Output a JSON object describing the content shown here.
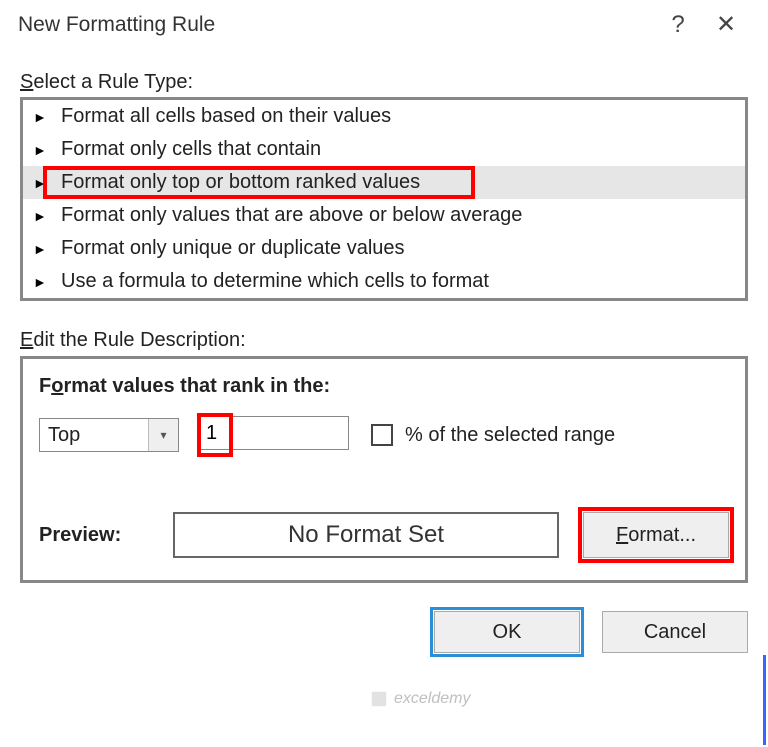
{
  "title": "New Formatting Rule",
  "help_icon": "?",
  "close_icon": "✕",
  "select_label_pre": "S",
  "select_label_rest": "elect a Rule Type:",
  "rules": [
    "Format all cells based on their values",
    "Format only cells that contain",
    "Format only top or bottom ranked values",
    "Format only values that are above or below average",
    "Format only unique or duplicate values",
    "Use a formula to determine which cells to format"
  ],
  "selected_rule_index": 2,
  "edit_label_pre": "E",
  "edit_label_rest": "dit the Rule Description:",
  "panel_title_pre": "F",
  "panel_title_und": "o",
  "panel_title_rest": "rmat values that rank in the:",
  "dropdown_value": "Top",
  "number_value": "1",
  "checkbox_label": "% of the selected range",
  "preview_label": "Preview:",
  "preview_text": "No Format Set",
  "format_btn_pre": "F",
  "format_btn_rest": "ormat...",
  "ok_label": "OK",
  "cancel_label": "Cancel",
  "watermark": "exceldemy"
}
